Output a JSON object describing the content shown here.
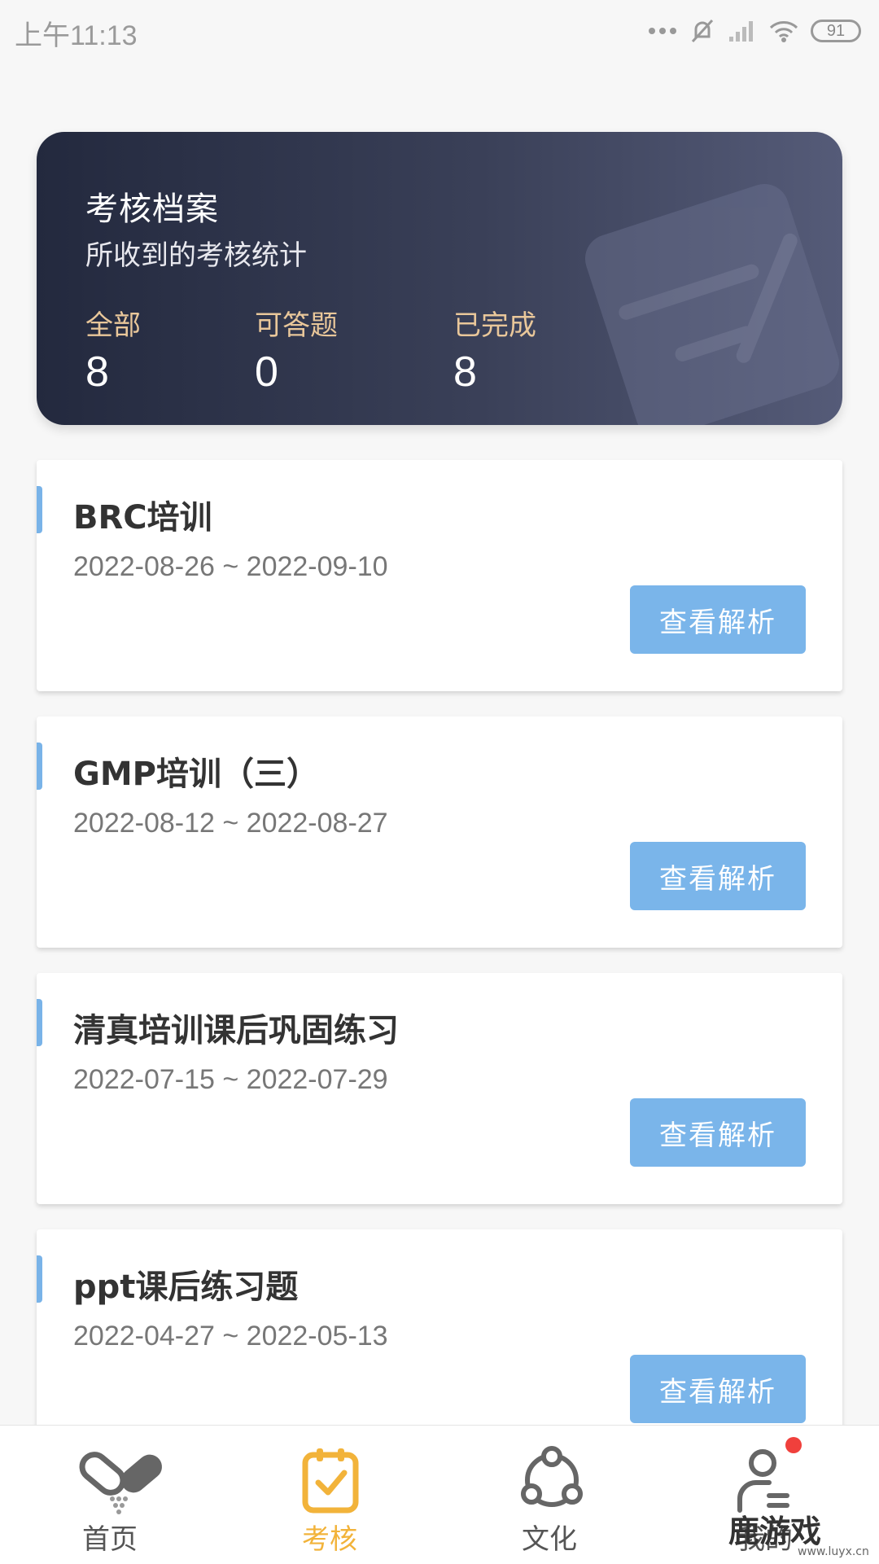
{
  "status_bar": {
    "time": "上午11:13",
    "battery": "91",
    "icons": [
      "dots-icon",
      "mute-icon",
      "signal-icon",
      "wifi-icon",
      "battery-icon"
    ]
  },
  "summary": {
    "title": "考核档案",
    "subtitle": "所收到的考核统计",
    "stats": [
      {
        "label": "全部",
        "value": "8"
      },
      {
        "label": "可答题",
        "value": "0"
      },
      {
        "label": "已完成",
        "value": "8"
      }
    ]
  },
  "exams": [
    {
      "title": "BRC培训",
      "dates": "2022-08-26 ~ 2022-09-10",
      "button": "查看解析"
    },
    {
      "title": "GMP培训（三）",
      "dates": "2022-08-12 ~ 2022-08-27",
      "button": "查看解析"
    },
    {
      "title": "清真培训课后巩固练习",
      "dates": "2022-07-15 ~ 2022-07-29",
      "button": "查看解析"
    },
    {
      "title": "ppt课后练习题",
      "dates": "2022-04-27 ~ 2022-05-13",
      "button": "查看解析"
    }
  ],
  "nav": {
    "items": [
      {
        "label": "首页",
        "icon": "pill-icon"
      },
      {
        "label": "考核",
        "icon": "clipboard-check-icon"
      },
      {
        "label": "文化",
        "icon": "network-icon"
      },
      {
        "label": "我的",
        "icon": "person-icon"
      }
    ],
    "active_color": "#f2b33a"
  },
  "watermark": {
    "text": "鹿游戏",
    "sub": "www.luyx.cn"
  },
  "colors": {
    "button": "#7ab5ea",
    "accent_bar": "#79b3e8",
    "stat_label": "#e9c79a"
  }
}
